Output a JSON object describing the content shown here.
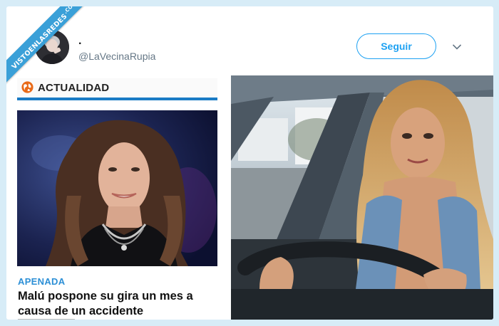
{
  "watermark": {
    "text": "VISTOENLASREDES",
    "suffix": ".COM"
  },
  "tweet": {
    "display_name": ".",
    "handle": "@LaVecinaRupia",
    "follow_label": "Seguir",
    "avatar_icon": "user-avatar",
    "menu_icon": "chevron-down-icon"
  },
  "left_image": {
    "section_icon": "globe-icon",
    "section_label": "ACTUALIDAD",
    "kicker": "APENADA",
    "headline": "Malú pospone su gira un mes a causa de un accidente"
  },
  "right_image": {
    "description_icon": "photo"
  },
  "colors": {
    "accent": "#1da1f2",
    "kicker": "#2c8fd6",
    "section_bar": "#1a7bc5",
    "background": "#d7ecf7"
  }
}
